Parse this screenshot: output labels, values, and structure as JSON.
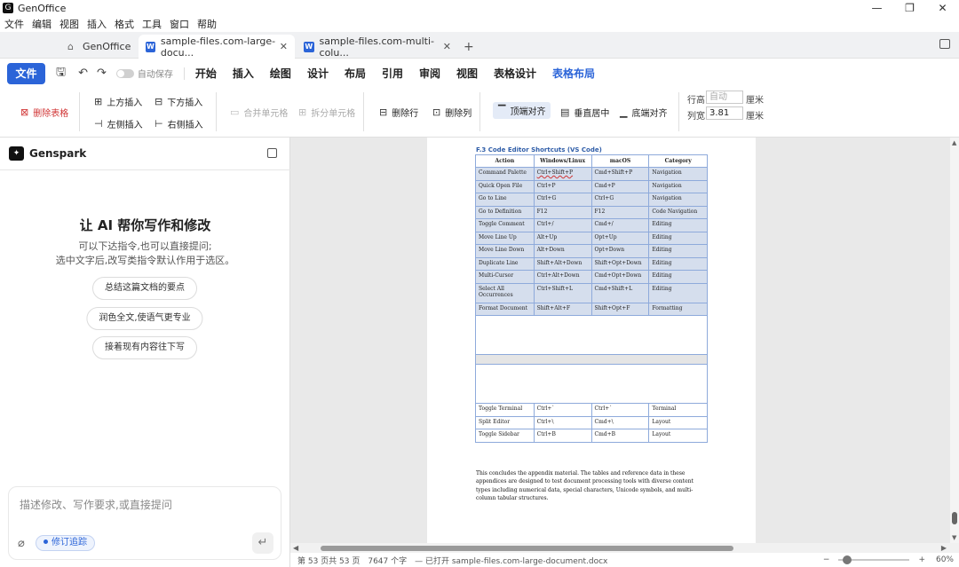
{
  "app": {
    "title": "GenOffice",
    "window_controls": [
      "—",
      "❐",
      "✕"
    ]
  },
  "menubar": [
    "文件",
    "编辑",
    "视图",
    "插入",
    "格式",
    "工具",
    "窗口",
    "帮助"
  ],
  "tabs": [
    {
      "label": "GenOffice",
      "icon": "home-icon"
    },
    {
      "label": "sample-files.com-large-docu...",
      "icon": "word-doc-icon",
      "close": "✕"
    },
    {
      "label": "sample-files.com-multi-colu...",
      "icon": "word-doc-icon",
      "close": "✕"
    }
  ],
  "ribbon_tabs": {
    "file": "文件",
    "autosave": "自动保存",
    "tabs": [
      "开始",
      "插入",
      "绘图",
      "设计",
      "布局",
      "引用",
      "审阅",
      "视图",
      "表格设计",
      "表格布局"
    ],
    "active": "表格布局"
  },
  "ribbon": {
    "delete_table": "删除表格",
    "insert_above": "上方插入",
    "insert_below": "下方插入",
    "insert_left": "左侧插入",
    "insert_right": "右侧插入",
    "merge_cells": "合并单元格",
    "split_cells": "拆分单元格",
    "delete_row": "删除行",
    "delete_col": "删除列",
    "align_top": "顶端对齐",
    "align_middle": "垂直居中",
    "align_bottom": "底端对齐",
    "row_height_label": "行高",
    "row_height_placeholder": "自动",
    "row_height_unit": "厘米",
    "col_width_label": "列宽",
    "col_width_value": "3.81",
    "col_width_unit": "厘米"
  },
  "assistant": {
    "name": "Genspark",
    "title": "让 AI 帮你写作和修改",
    "desc_line1": "可以下达指令,也可以直接提问;",
    "desc_line2": "选中文字后,改写类指令默认作用于选区。",
    "suggestions": [
      "总结这篇文档的要点",
      "润色全文,使语气更专业",
      "接着现有内容往下写"
    ],
    "input_placeholder": "描述修改、写作要求,或直接提问",
    "track_changes": "修订追踪"
  },
  "document": {
    "heading": "F.3 Code Editor Shortcuts (VS Code)",
    "table": {
      "headers": [
        "Action",
        "Windows/Linux",
        "macOS",
        "Category"
      ],
      "rows": [
        [
          "Command Palette",
          "Ctrl+Shift+P",
          "Cmd+Shift+P",
          "Navigation"
        ],
        [
          "Quick Open File",
          "Ctrl+P",
          "Cmd+P",
          "Navigation"
        ],
        [
          "Go to Line",
          "Ctrl+G",
          "Ctrl+G",
          "Navigation"
        ],
        [
          "Go to Definition",
          "F12",
          "F12",
          "Code Navigation"
        ],
        [
          "Toggle Comment",
          "Ctrl+/",
          "Cmd+/",
          "Editing"
        ],
        [
          "Move Line Up",
          "Alt+Up",
          "Opt+Up",
          "Editing"
        ],
        [
          "Move Line Down",
          "Alt+Down",
          "Opt+Down",
          "Editing"
        ],
        [
          "Duplicate Line",
          "Shift+Alt+Down",
          "Shift+Opt+Down",
          "Editing"
        ],
        [
          "Multi-Cursor",
          "Ctrl+Alt+Down",
          "Cmd+Opt+Down",
          "Editing"
        ],
        [
          "Select All Occurrences",
          "Ctrl+Shift+L",
          "Cmd+Shift+L",
          "Editing"
        ],
        [
          "Format Document",
          "Shift+Alt+F",
          "Shift+Opt+F",
          "Formatting"
        ],
        [
          "",
          "",
          "",
          ""
        ],
        [
          "",
          "",
          "",
          ""
        ],
        [
          "",
          "",
          "",
          ""
        ],
        [
          "Toggle Terminal",
          "Ctrl+`",
          "Ctrl+`",
          "Terminal"
        ],
        [
          "Split Editor",
          "Ctrl+\\",
          "Cmd+\\",
          "Layout"
        ],
        [
          "Toggle Sidebar",
          "Ctrl+B",
          "Cmd+B",
          "Layout"
        ]
      ]
    },
    "paragraph": "This concludes the appendix material. The tables and reference data in these appendices are designed to test document processing tools with diverse content types including numerical data, special characters, Unicode symbols, and multi-column tabular structures."
  },
  "status": {
    "page": "第 53 页共 53 页",
    "words": "7647 个字",
    "opened": "— 已打开 sample-files.com-large-document.docx",
    "zoom_minus": "−",
    "zoom_plus": "+",
    "zoom": "60%"
  },
  "colors": {
    "accent": "#2b64d8",
    "danger": "#d03434",
    "table_border": "#8eaadb",
    "selected_row": "#d5deed"
  }
}
